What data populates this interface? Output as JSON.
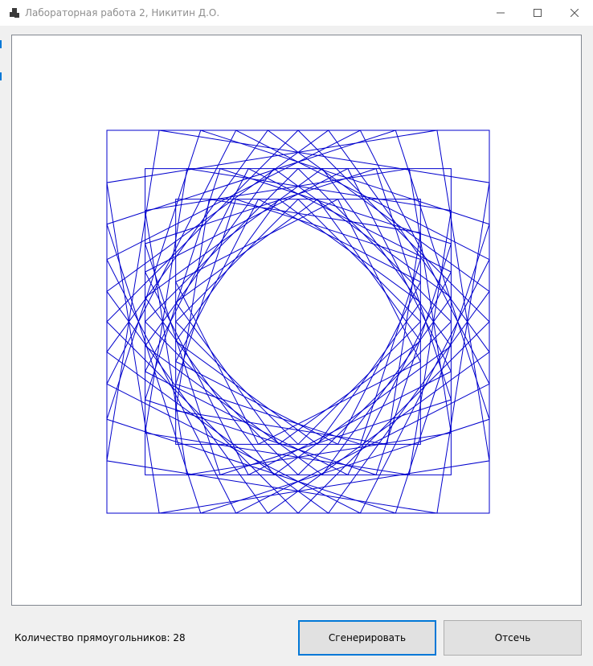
{
  "window": {
    "title": "Лабораторная работа 2, Никитин Д.О."
  },
  "status": {
    "count_text": "Количество прямоугольников: 28"
  },
  "buttons": {
    "generate_label": "Сгенерировать",
    "clip_label": "Отсечь"
  },
  "drawing": {
    "rectangle_count": 28,
    "stroke_color": "#0000cd",
    "shape": "nested rotated squares spiral"
  },
  "icons": {
    "app": "app-icon",
    "minimize": "minimize-icon",
    "maximize": "maximize-icon",
    "close": "close-icon"
  }
}
